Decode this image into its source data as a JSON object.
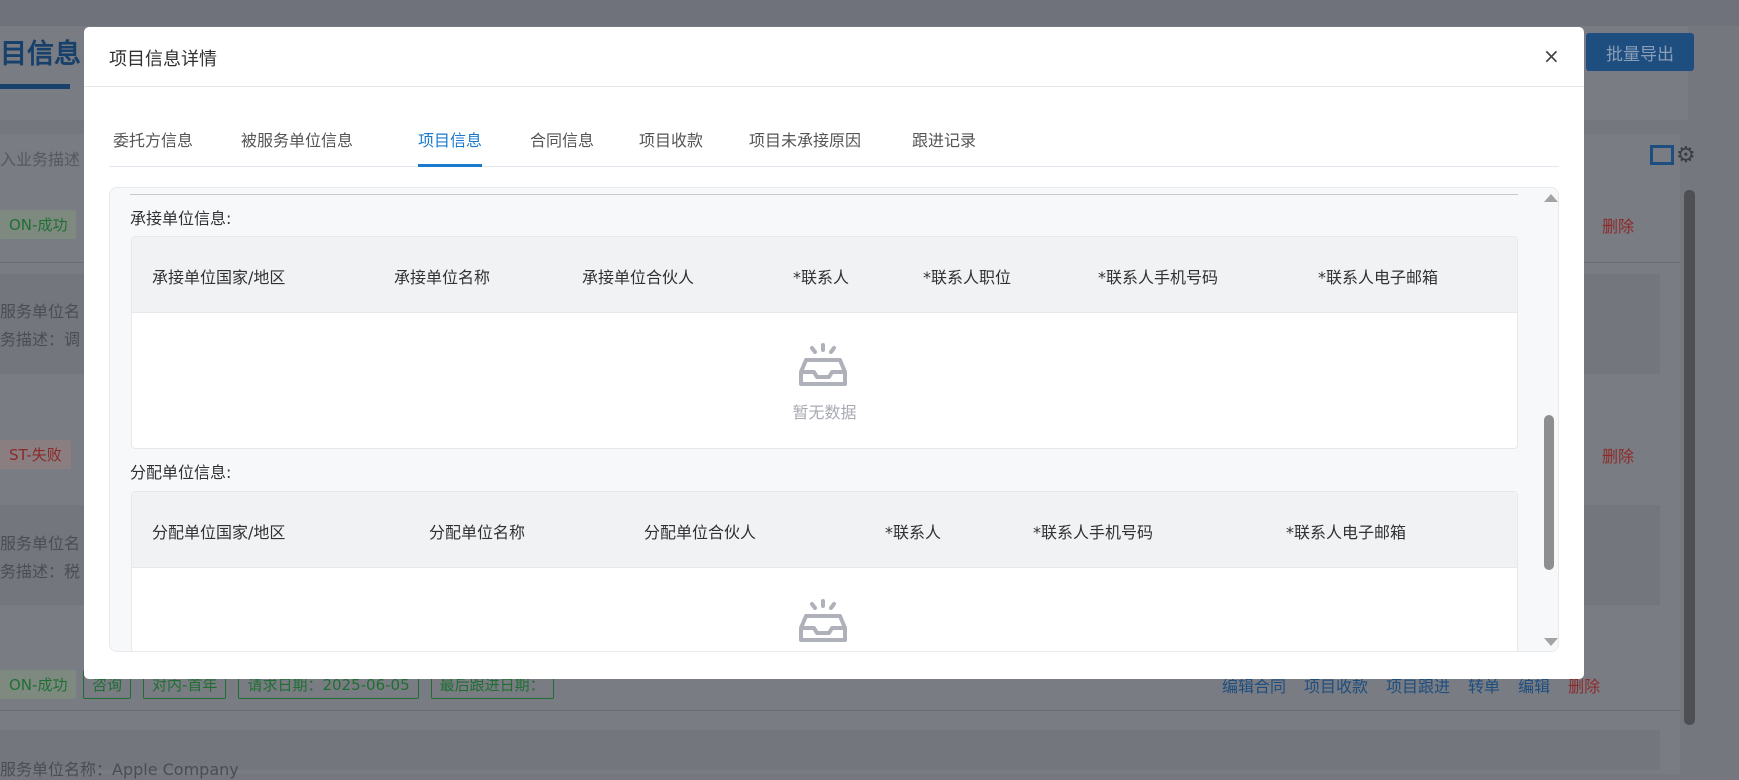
{
  "background": {
    "page_title": "目信息",
    "export_button": "批量导出",
    "search_placeholder": "入业务描述",
    "rows": [
      {
        "status": "ON-成功",
        "line1": "服务单位名",
        "line2": "务描述：调",
        "delete": "删除"
      },
      {
        "status": "ST-失败",
        "line1": "服务单位名",
        "line2": "务描述：税",
        "delete": "删除"
      },
      {
        "status": "ON-成功",
        "tags": [
          "咨询",
          "对内-首年",
          "请求日期：2025-06-05",
          "最后跟进日期："
        ],
        "actions": [
          "编辑合同",
          "项目收款",
          "项目跟进",
          "转单",
          "编辑"
        ],
        "delete": "删除",
        "line1": "服务单位名称：Apple Company"
      }
    ]
  },
  "modal": {
    "title": "项目信息详情",
    "close": "×",
    "tabs": [
      {
        "label": "委托方信息",
        "active": false
      },
      {
        "label": "被服务单位信息",
        "active": false
      },
      {
        "label": "项目信息",
        "active": true
      },
      {
        "label": "合同信息",
        "active": false
      },
      {
        "label": "项目收款",
        "active": false
      },
      {
        "label": "项目未承接原因",
        "active": false
      },
      {
        "label": "跟进记录",
        "active": false
      }
    ],
    "accepting_unit": {
      "label": "承接单位信息:",
      "columns": [
        "承接单位国家/地区",
        "承接单位名称",
        "承接单位合伙人",
        "*联系人",
        "*联系人职位",
        "*联系人手机号码",
        "*联系人电子邮箱"
      ],
      "empty_text": "暂无数据"
    },
    "allocating_unit": {
      "label": "分配单位信息:",
      "columns": [
        "分配单位国家/地区",
        "分配单位名称",
        "分配单位合伙人",
        "*联系人",
        "*联系人手机号码",
        "*联系人电子邮箱"
      ]
    }
  },
  "colors": {
    "accent": "#1a7ad0",
    "delete": "#d03a3a",
    "success": "#1f8a3a"
  }
}
